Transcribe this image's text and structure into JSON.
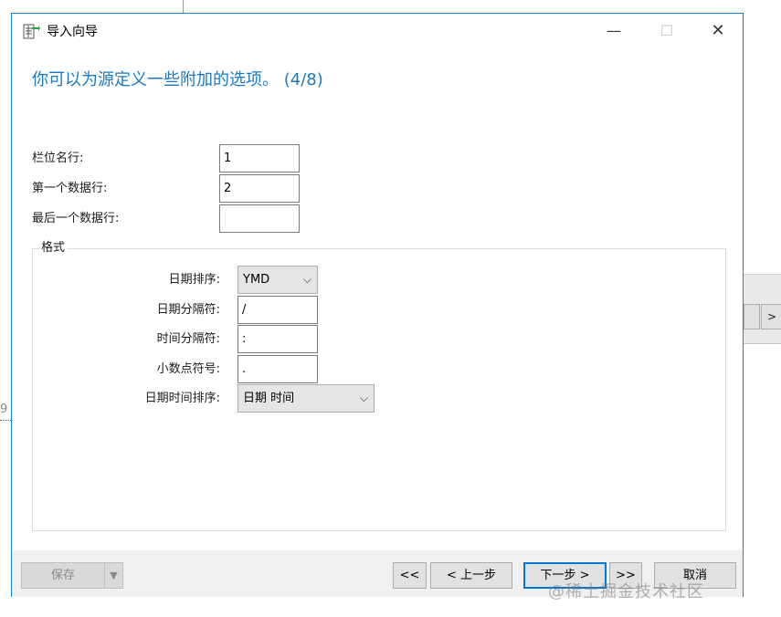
{
  "window": {
    "title": "导入向导",
    "minimize": "—",
    "maximize": "☐",
    "close": "✕"
  },
  "heading": "你可以为源定义一些附加的选项。 (4/8)",
  "fields": {
    "field_name_row": {
      "label": "栏位名行:",
      "value": "1"
    },
    "first_data_row": {
      "label": "第一个数据行:",
      "value": "2"
    },
    "last_data_row": {
      "label": "最后一个数据行:",
      "value": ""
    }
  },
  "format": {
    "legend": "格式",
    "date_order": {
      "label": "日期排序:",
      "value": "YMD"
    },
    "date_separator": {
      "label": "日期分隔符:",
      "value": "/"
    },
    "time_separator": {
      "label": "时间分隔符:",
      "value": ":"
    },
    "decimal_symbol": {
      "label": "小数点符号:",
      "value": "."
    },
    "datetime_order": {
      "label": "日期时间排序:",
      "value": "日期 时间"
    }
  },
  "footer": {
    "save": "保存",
    "first": "<<",
    "prev": "< 上一步",
    "next": "下一步 >",
    "last": ">>",
    "cancel": "取消"
  },
  "background": {
    "right_button": ">",
    "left_mark": "9"
  },
  "watermark": "@稀土掘金技术社区",
  "colors": {
    "accent": "#1883d7",
    "heading": "#1b7abf"
  }
}
